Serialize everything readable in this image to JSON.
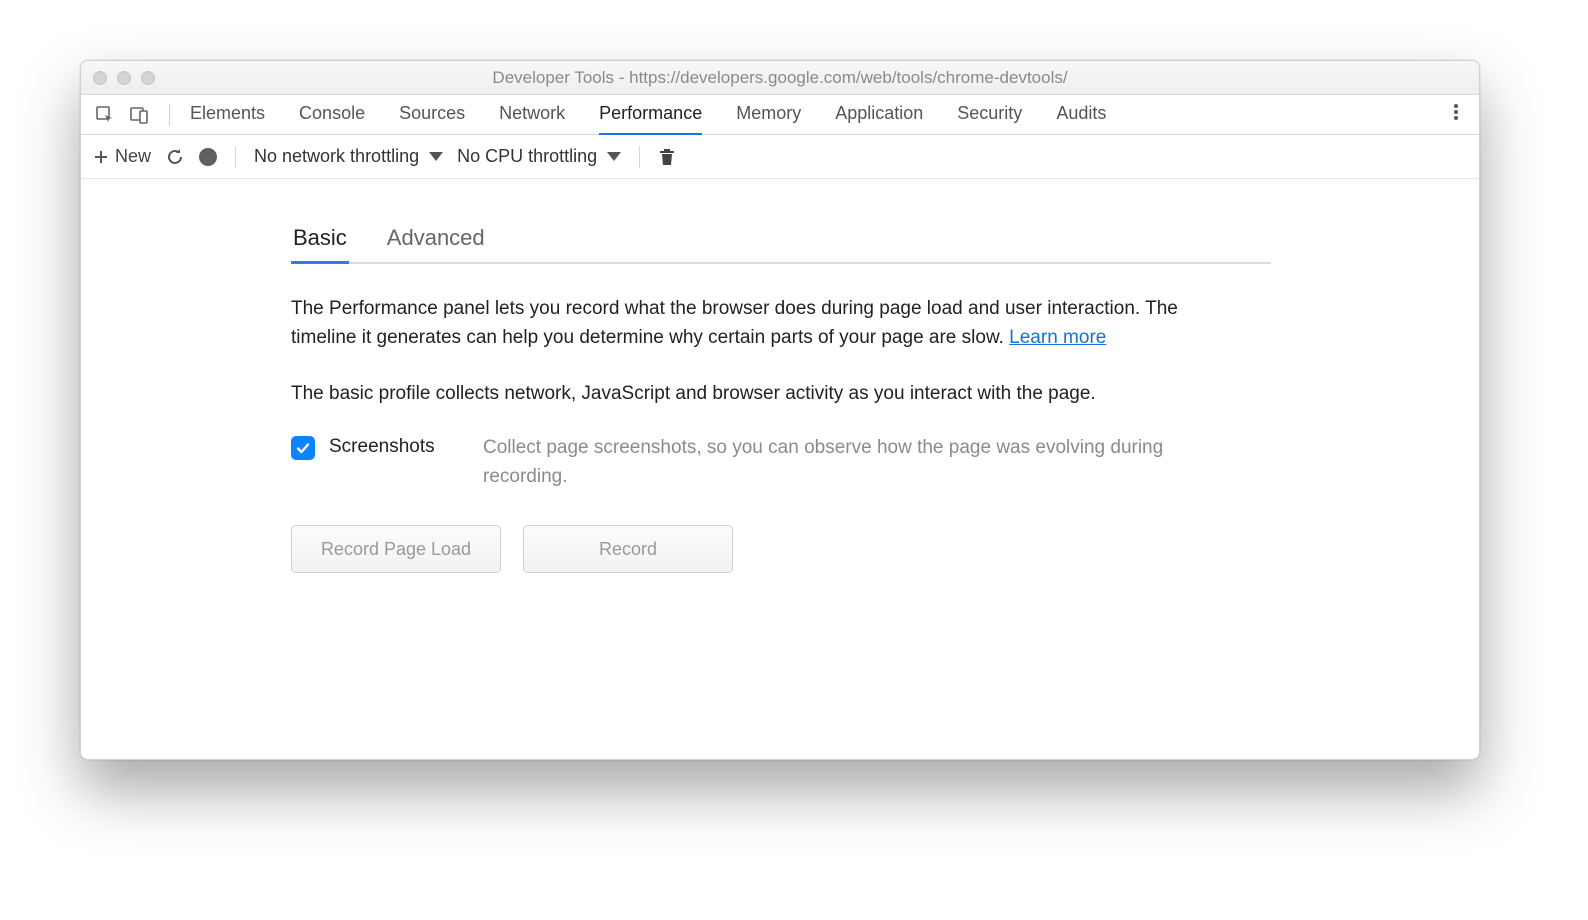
{
  "window": {
    "title": "Developer Tools - https://developers.google.com/web/tools/chrome-devtools/"
  },
  "tabs": {
    "items": [
      {
        "label": "Elements"
      },
      {
        "label": "Console"
      },
      {
        "label": "Sources"
      },
      {
        "label": "Network"
      },
      {
        "label": "Performance",
        "active": true
      },
      {
        "label": "Memory"
      },
      {
        "label": "Application"
      },
      {
        "label": "Security"
      },
      {
        "label": "Audits"
      }
    ]
  },
  "toolbar": {
    "new_label": "New",
    "network_throttle": "No network throttling",
    "cpu_throttle": "No CPU throttling"
  },
  "subtabs": {
    "basic": "Basic",
    "advanced": "Advanced"
  },
  "panel": {
    "intro_text": "The Performance panel lets you record what the browser does during page load and user interaction. The timeline it generates can help you determine why certain parts of your page are slow.  ",
    "learn_more": "Learn more",
    "basic_profile_text": "The basic profile collects network, JavaScript and browser activity as you interact with the page.",
    "option": {
      "label": "Screenshots",
      "description": "Collect page screenshots, so you can observe how the page was evolving during recording.",
      "checked": true
    },
    "buttons": {
      "record_page_load": "Record Page Load",
      "record": "Record"
    }
  }
}
